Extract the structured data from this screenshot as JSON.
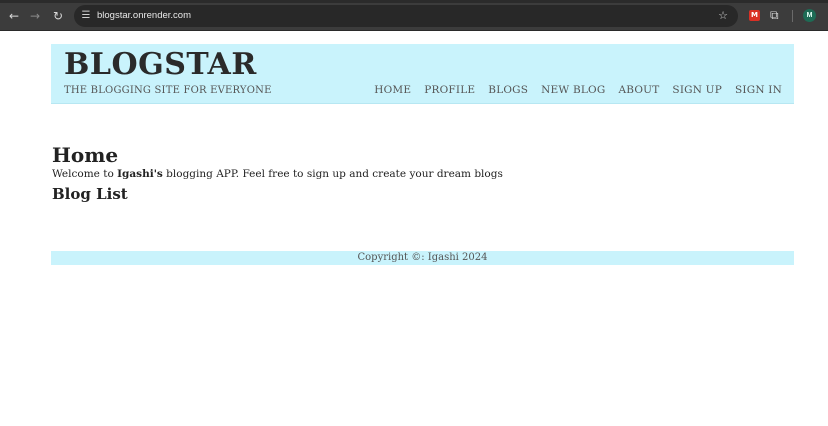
{
  "browser": {
    "url": "blogstar.onrender.com",
    "profile_initial": "M",
    "icons": {
      "back": "arrow-left-icon",
      "forward": "arrow-right-icon",
      "reload": "reload-icon",
      "site_info": "site-info-icon",
      "bookmark": "star-icon",
      "extension": "puzzle-icon"
    }
  },
  "header": {
    "brand": "BLOGSTAR",
    "tagline": "THE BLOGGING SITE FOR EVERYONE",
    "nav": [
      "HOME",
      "PROFILE",
      "BLOGS",
      "NEW BLOG",
      "ABOUT",
      "SIGN UP",
      "SIGN IN"
    ]
  },
  "main": {
    "title": "Home",
    "welcome_prefix": "Welcome to ",
    "welcome_name": "Igashi's",
    "welcome_suffix": " blogging APP. Feel free to sign up and create your dream blogs",
    "blog_list_title": "Blog List"
  },
  "footer": {
    "text": "Copyright ©: Igashi 2024"
  },
  "colors": {
    "header_bg": "#c9f3fc",
    "browser_bar": "#3c3c3c"
  }
}
